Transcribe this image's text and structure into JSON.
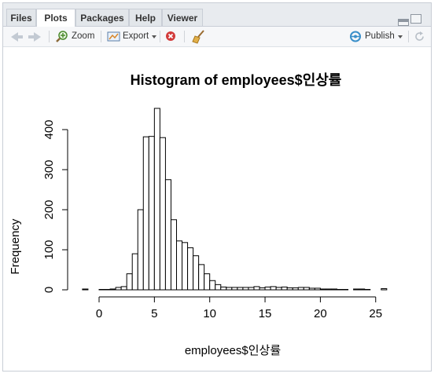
{
  "tabs": [
    {
      "label": "Files"
    },
    {
      "label": "Plots"
    },
    {
      "label": "Packages"
    },
    {
      "label": "Help"
    },
    {
      "label": "Viewer"
    }
  ],
  "active_tab": "Plots",
  "toolbar": {
    "zoom_label": "Zoom",
    "export_label": "Export",
    "publish_label": "Publish"
  },
  "chart_data": {
    "type": "bar",
    "title": "Histogram of employees$인상률",
    "xlabel": "employees$인상률",
    "ylabel": "Frequency",
    "x_ticks": [
      0,
      5,
      10,
      15,
      20,
      25
    ],
    "y_ticks": [
      0,
      100,
      200,
      300,
      400
    ],
    "xlim": [
      -2.5,
      26
    ],
    "ylim": [
      0,
      455
    ],
    "bin_width": 0.5,
    "bins_start": [
      -1.5,
      -1,
      -0.5,
      0,
      0.5,
      1,
      1.5,
      2,
      2.5,
      3,
      3.5,
      4,
      4.5,
      5,
      5.5,
      6,
      6.5,
      7,
      7.5,
      8,
      8.5,
      9,
      9.5,
      10,
      10.5,
      11,
      11.5,
      12,
      12.5,
      13,
      13.5,
      14,
      14.5,
      15,
      15.5,
      16,
      16.5,
      17,
      17.5,
      18,
      18.5,
      19,
      19.5,
      20,
      20.5,
      21,
      21.5,
      22,
      22.5,
      23,
      23.5,
      24,
      24.5,
      25,
      25.5
    ],
    "values": [
      2,
      0,
      0,
      1,
      1,
      2,
      6,
      8,
      40,
      90,
      200,
      382,
      383,
      453,
      380,
      275,
      175,
      122,
      118,
      105,
      85,
      63,
      40,
      23,
      13,
      7,
      6,
      6,
      6,
      6,
      6,
      8,
      5,
      7,
      8,
      6,
      7,
      5,
      5,
      6,
      6,
      4,
      4,
      2,
      2,
      2,
      1,
      1,
      0,
      2,
      2,
      1,
      0,
      0,
      3
    ],
    "grid": false,
    "legend": "none"
  }
}
